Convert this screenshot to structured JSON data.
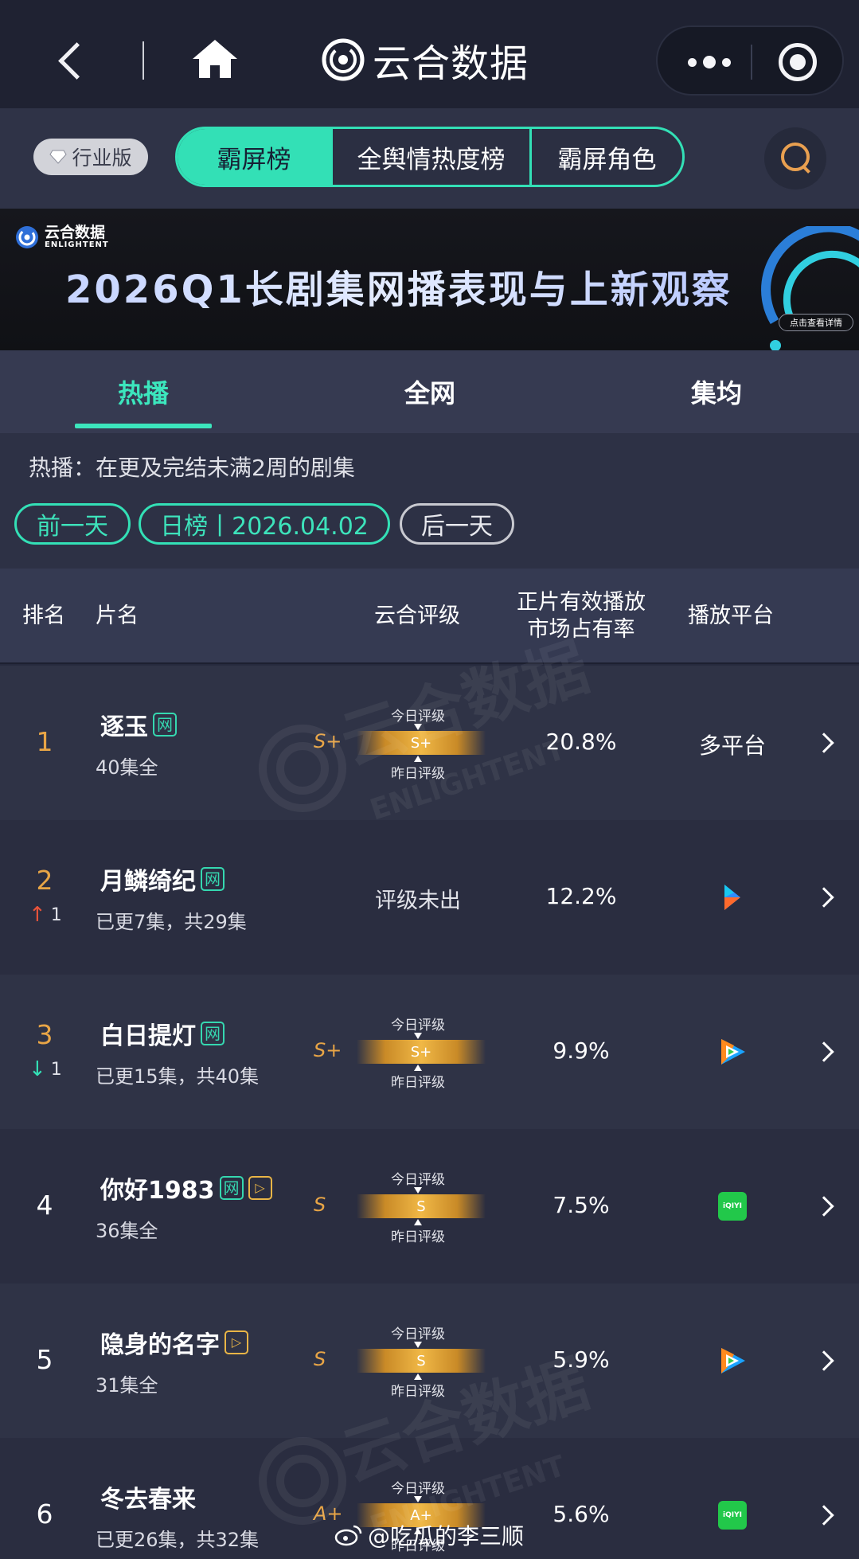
{
  "nav": {
    "brand": "云合数据"
  },
  "segment": {
    "industry_badge": "行业版",
    "items": [
      "霸屏榜",
      "全舆情热度榜",
      "霸屏角色"
    ],
    "active": 0
  },
  "banner": {
    "logo_cn": "云合数据",
    "logo_en": "ENLIGHTENT",
    "title": "2026Q1长剧集网播表现与上新观察",
    "cta": "点击查看详情"
  },
  "tabs": {
    "items": [
      "热播",
      "全网",
      "集均"
    ],
    "active": 0
  },
  "filter": {
    "description": "热播：在更及完结未满2周的剧集",
    "prev": "前一天",
    "date": "日榜丨2026.04.02",
    "next": "后一天"
  },
  "table": {
    "headers": {
      "rank": "排名",
      "title": "片名",
      "grade": "云合评级",
      "share_line1": "正片有效播放",
      "share_line2": "市场占有率",
      "platform": "播放平台"
    },
    "grade_today_label": "今日评级",
    "grade_yesterday_label": "昨日评级",
    "rows": [
      {
        "rank": "1",
        "title": "逐玉",
        "tags": [
          "网"
        ],
        "episodes": "40集全",
        "grade": "S+",
        "grade_bar": "S+",
        "share": "20.8%",
        "platform": "多平台",
        "platform_icon": "multi-platform",
        "trend": ""
      },
      {
        "rank": "2",
        "title": "月鳞绮纪",
        "tags": [
          "网"
        ],
        "episodes": "已更7集，共29集",
        "grade": "评级未出",
        "share": "12.2%",
        "platform_icon": "youku-icon",
        "trend": "1",
        "trend_dir": "up"
      },
      {
        "rank": "3",
        "title": "白日提灯",
        "tags": [
          "网"
        ],
        "episodes": "已更15集，共40集",
        "grade": "S+",
        "grade_bar": "S+",
        "share": "9.9%",
        "platform_icon": "tencent-video-icon",
        "trend": "1",
        "trend_dir": "down"
      },
      {
        "rank": "4",
        "title": "你好1983",
        "tags": [
          "网",
          "▷"
        ],
        "episodes": "36集全",
        "grade": "S",
        "grade_bar": "S",
        "share": "7.5%",
        "platform_icon": "iqiyi-icon",
        "trend": ""
      },
      {
        "rank": "5",
        "title": "隐身的名字",
        "tags": [
          "▷"
        ],
        "episodes": "31集全",
        "grade": "S",
        "grade_bar": "S",
        "share": "5.9%",
        "platform_icon": "tencent-video-icon",
        "trend": ""
      },
      {
        "rank": "6",
        "title": "冬去春来",
        "tags": [],
        "episodes": "已更26集，共32集",
        "grade": "A+",
        "grade_bar": "A+",
        "share": "5.6%",
        "platform_icon": "iqiyi-icon",
        "trend": ""
      }
    ]
  },
  "platform_logos": {
    "iqiyi": "iQIYI"
  },
  "watermark": {
    "weibo": "@吃瓜的李三顺"
  },
  "colors": {
    "accent": "#33e0b6",
    "rank_top": "#e8a546",
    "grade": "#e8a546",
    "up": "#e8533a",
    "down": "#33e0b6"
  }
}
